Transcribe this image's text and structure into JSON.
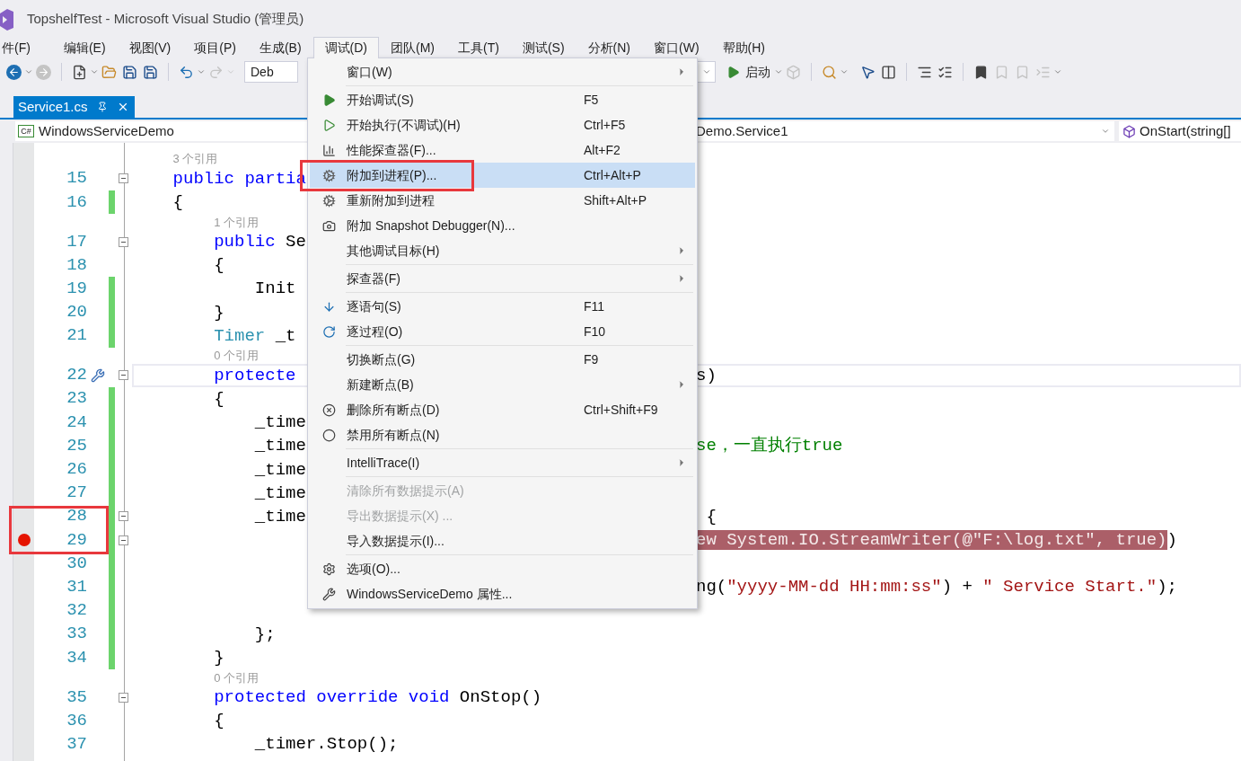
{
  "window": {
    "title": "TopshelfTest - Microsoft Visual Studio (管理员)"
  },
  "menu_bar": [
    {
      "label": "件(F)",
      "selected": false
    },
    {
      "label": "编辑(E)",
      "selected": false
    },
    {
      "label": "视图(V)",
      "selected": false
    },
    {
      "label": "项目(P)",
      "selected": false
    },
    {
      "label": "生成(B)",
      "selected": false
    },
    {
      "label": "调试(D)",
      "selected": true
    },
    {
      "label": "团队(M)",
      "selected": false
    },
    {
      "label": "工具(T)",
      "selected": false
    },
    {
      "label": "测试(S)",
      "selected": false
    },
    {
      "label": "分析(N)",
      "selected": false
    },
    {
      "label": "窗口(W)",
      "selected": false
    },
    {
      "label": "帮助(H)",
      "selected": false
    }
  ],
  "toolbar": {
    "configuration": "Deb",
    "start_label": "启动"
  },
  "tabs": [
    {
      "label": "Service1.cs",
      "selected": true
    }
  ],
  "navigation": {
    "project_badge": "C#",
    "project": "WindowsServiceDemo",
    "type": "Demo.Service1",
    "member": "OnStart(string[]"
  },
  "debug_menu": {
    "items": [
      {
        "kind": "item",
        "label": "窗口(W)",
        "submenu": true,
        "selected": false,
        "disabled": false,
        "outlined": false
      },
      {
        "kind": "separator"
      },
      {
        "kind": "item",
        "label": "开始调试(S)",
        "shortcut": "F5",
        "submenu": false,
        "selected": false,
        "disabled": false,
        "outlined": false
      },
      {
        "kind": "item",
        "label": "开始执行(不调试)(H)",
        "shortcut": "Ctrl+F5",
        "submenu": false,
        "selected": false,
        "disabled": false,
        "outlined": false
      },
      {
        "kind": "item",
        "label": "性能探查器(F)...",
        "shortcut": "Alt+F2",
        "submenu": false,
        "selected": false,
        "disabled": false,
        "outlined": false
      },
      {
        "kind": "item",
        "label": "附加到进程(P)...",
        "shortcut": "Ctrl+Alt+P",
        "submenu": false,
        "selected": true,
        "disabled": false,
        "outlined": true
      },
      {
        "kind": "item",
        "label": "重新附加到进程",
        "shortcut": "Shift+Alt+P",
        "submenu": false,
        "selected": false,
        "disabled": false,
        "outlined": false
      },
      {
        "kind": "item",
        "label": "附加 Snapshot Debugger(N)...",
        "submenu": false,
        "selected": false,
        "disabled": false,
        "outlined": false
      },
      {
        "kind": "item",
        "label": "其他调试目标(H)",
        "submenu": true,
        "selected": false,
        "disabled": false,
        "outlined": false
      },
      {
        "kind": "separator"
      },
      {
        "kind": "item",
        "label": "探查器(F)",
        "submenu": true,
        "selected": false,
        "disabled": false,
        "outlined": false
      },
      {
        "kind": "separator"
      },
      {
        "kind": "item",
        "label": "逐语句(S)",
        "shortcut": "F11",
        "submenu": false,
        "selected": false,
        "disabled": false,
        "outlined": false
      },
      {
        "kind": "item",
        "label": "逐过程(O)",
        "shortcut": "F10",
        "submenu": false,
        "selected": false,
        "disabled": false,
        "outlined": false
      },
      {
        "kind": "separator"
      },
      {
        "kind": "item",
        "label": "切换断点(G)",
        "shortcut": "F9",
        "submenu": false,
        "selected": false,
        "disabled": false,
        "outlined": false
      },
      {
        "kind": "item",
        "label": "新建断点(B)",
        "submenu": true,
        "selected": false,
        "disabled": false,
        "outlined": false
      },
      {
        "kind": "item",
        "label": "删除所有断点(D)",
        "shortcut": "Ctrl+Shift+F9",
        "submenu": false,
        "selected": false,
        "disabled": false,
        "outlined": false
      },
      {
        "kind": "item",
        "label": "禁用所有断点(N)",
        "submenu": false,
        "selected": false,
        "disabled": false,
        "outlined": false
      },
      {
        "kind": "separator"
      },
      {
        "kind": "item",
        "label": "IntelliTrace(I)",
        "submenu": true,
        "selected": false,
        "disabled": false,
        "outlined": false
      },
      {
        "kind": "separator"
      },
      {
        "kind": "item",
        "label": "清除所有数据提示(A)",
        "submenu": false,
        "selected": false,
        "disabled": true,
        "outlined": false
      },
      {
        "kind": "item",
        "label": "导出数据提示(X) ...",
        "submenu": false,
        "selected": false,
        "disabled": true,
        "outlined": false
      },
      {
        "kind": "item",
        "label": "导入数据提示(I)...",
        "submenu": false,
        "selected": false,
        "disabled": false,
        "outlined": false
      },
      {
        "kind": "separator"
      },
      {
        "kind": "item",
        "label": "选项(O)...",
        "submenu": false,
        "selected": false,
        "disabled": false,
        "outlined": false
      },
      {
        "kind": "item",
        "label": "WindowsServiceDemo 属性...",
        "submenu": false,
        "selected": false,
        "disabled": false,
        "outlined": false
      }
    ]
  },
  "editor": {
    "lines": [
      {
        "kind": "codelens",
        "text": "    3 个引用"
      },
      {
        "kind": "code",
        "number": "15",
        "changed": false,
        "foldable": true,
        "breakpoint": false,
        "current": false,
        "quick_action": false,
        "outlined": false,
        "left": [
          {
            "kind": "keyword",
            "text": "    public partia"
          }
        ]
      },
      {
        "kind": "code",
        "number": "16",
        "changed": true,
        "foldable": false,
        "breakpoint": false,
        "current": false,
        "quick_action": false,
        "outlined": false,
        "left": [
          {
            "kind": "plain",
            "text": "    {"
          }
        ]
      },
      {
        "kind": "codelens",
        "text": "        1 个引用"
      },
      {
        "kind": "code",
        "number": "17",
        "changed": false,
        "foldable": true,
        "breakpoint": false,
        "current": false,
        "quick_action": false,
        "outlined": false,
        "left": [
          {
            "kind": "keyword",
            "text": "        public"
          },
          {
            "kind": "plain",
            "text": " Se"
          }
        ]
      },
      {
        "kind": "code",
        "number": "18",
        "changed": false,
        "foldable": false,
        "breakpoint": false,
        "current": false,
        "quick_action": false,
        "outlined": false,
        "left": [
          {
            "kind": "plain",
            "text": "        {"
          }
        ]
      },
      {
        "kind": "code",
        "number": "19",
        "changed": true,
        "foldable": false,
        "breakpoint": false,
        "current": false,
        "quick_action": false,
        "outlined": false,
        "left": [
          {
            "kind": "plain",
            "text": "            Init"
          }
        ]
      },
      {
        "kind": "code",
        "number": "20",
        "changed": true,
        "foldable": false,
        "breakpoint": false,
        "current": false,
        "quick_action": false,
        "outlined": false,
        "left": [
          {
            "kind": "plain",
            "text": "        }"
          }
        ]
      },
      {
        "kind": "code",
        "number": "21",
        "changed": true,
        "foldable": false,
        "breakpoint": false,
        "current": false,
        "quick_action": false,
        "outlined": false,
        "left": [
          {
            "kind": "type",
            "text": "        Timer"
          },
          {
            "kind": "plain",
            "text": " _t"
          }
        ]
      },
      {
        "kind": "codelens",
        "text": "        0 个引用"
      },
      {
        "kind": "code",
        "number": "22",
        "changed": false,
        "foldable": true,
        "breakpoint": false,
        "current": true,
        "quick_action": true,
        "outlined": false,
        "left": [
          {
            "kind": "keyword",
            "text": "        protecte"
          }
        ],
        "right": [
          {
            "kind": "plain",
            "text": "s)"
          }
        ]
      },
      {
        "kind": "code",
        "number": "23",
        "changed": true,
        "foldable": false,
        "breakpoint": false,
        "current": false,
        "quick_action": false,
        "outlined": false,
        "left": [
          {
            "kind": "plain",
            "text": "        {"
          }
        ]
      },
      {
        "kind": "code",
        "number": "24",
        "changed": true,
        "foldable": false,
        "breakpoint": false,
        "current": false,
        "quick_action": false,
        "outlined": false,
        "left": [
          {
            "kind": "plain",
            "text": "            _time"
          }
        ]
      },
      {
        "kind": "code",
        "number": "25",
        "changed": true,
        "foldable": false,
        "breakpoint": false,
        "current": false,
        "quick_action": false,
        "outlined": false,
        "left": [
          {
            "kind": "plain",
            "text": "            _time"
          }
        ],
        "right": [
          {
            "kind": "comment",
            "text": "se，一直执行true"
          }
        ]
      },
      {
        "kind": "code",
        "number": "26",
        "changed": true,
        "foldable": false,
        "breakpoint": false,
        "current": false,
        "quick_action": false,
        "outlined": false,
        "left": [
          {
            "kind": "plain",
            "text": "            _time"
          }
        ]
      },
      {
        "kind": "code",
        "number": "27",
        "changed": true,
        "foldable": false,
        "breakpoint": false,
        "current": false,
        "quick_action": false,
        "outlined": false,
        "left": [
          {
            "kind": "plain",
            "text": "            _time"
          }
        ]
      },
      {
        "kind": "code",
        "number": "28",
        "changed": true,
        "foldable": true,
        "breakpoint": false,
        "current": false,
        "quick_action": false,
        "outlined": true,
        "left": [
          {
            "kind": "plain",
            "text": "            _time"
          }
        ],
        "right": [
          {
            "kind": "plain",
            "text": " {"
          }
        ]
      },
      {
        "kind": "code",
        "number": "29",
        "changed": true,
        "foldable": true,
        "breakpoint": true,
        "current": false,
        "quick_action": false,
        "outlined": true,
        "right": [
          {
            "kind": "breakpoint",
            "text": "ew System.IO.StreamWriter(@\"F:\\log.txt\", true)"
          },
          {
            "kind": "plain",
            "text": ")"
          }
        ]
      },
      {
        "kind": "code",
        "number": "30",
        "changed": true,
        "foldable": false,
        "breakpoint": false,
        "current": false,
        "quick_action": false,
        "outlined": false
      },
      {
        "kind": "code",
        "number": "31",
        "changed": true,
        "foldable": false,
        "breakpoint": false,
        "current": false,
        "quick_action": false,
        "outlined": false,
        "right": [
          {
            "kind": "plain",
            "text": "ng("
          },
          {
            "kind": "string",
            "text": "\"yyyy-MM-dd HH:mm:ss\""
          },
          {
            "kind": "plain",
            "text": ") + "
          },
          {
            "kind": "string",
            "text": "\" Service Start.\""
          },
          {
            "kind": "plain",
            "text": ");"
          }
        ]
      },
      {
        "kind": "code",
        "number": "32",
        "changed": true,
        "foldable": false,
        "breakpoint": false,
        "current": false,
        "quick_action": false,
        "outlined": false
      },
      {
        "kind": "code",
        "number": "33",
        "changed": true,
        "foldable": false,
        "breakpoint": false,
        "current": false,
        "quick_action": false,
        "outlined": false,
        "left": [
          {
            "kind": "plain",
            "text": "            };"
          }
        ]
      },
      {
        "kind": "code",
        "number": "34",
        "changed": true,
        "foldable": false,
        "breakpoint": false,
        "current": false,
        "quick_action": false,
        "outlined": false,
        "left": [
          {
            "kind": "plain",
            "text": "        }"
          }
        ]
      },
      {
        "kind": "codelens",
        "text": "        0 个引用"
      },
      {
        "kind": "code",
        "number": "35",
        "changed": false,
        "foldable": true,
        "breakpoint": false,
        "current": false,
        "quick_action": false,
        "outlined": false,
        "left": [
          {
            "kind": "keyword",
            "text": "        protected override void"
          },
          {
            "kind": "plain",
            "text": " OnStop()"
          }
        ]
      },
      {
        "kind": "code",
        "number": "36",
        "changed": false,
        "foldable": false,
        "breakpoint": false,
        "current": false,
        "quick_action": false,
        "outlined": false,
        "left": [
          {
            "kind": "plain",
            "text": "        {"
          }
        ]
      },
      {
        "kind": "code",
        "number": "37",
        "changed": false,
        "foldable": false,
        "breakpoint": false,
        "current": false,
        "quick_action": false,
        "outlined": false,
        "left": [
          {
            "kind": "plain",
            "text": "            _timer.Stop();"
          }
        ]
      }
    ]
  }
}
